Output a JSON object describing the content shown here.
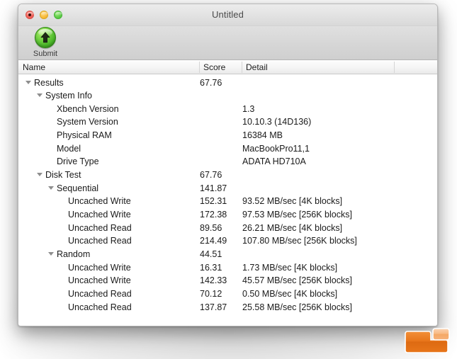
{
  "window": {
    "title": "Untitled",
    "traffic_lights": [
      {
        "name": "close",
        "color": "#f2655c"
      },
      {
        "name": "minimize",
        "color": "#f9bd3f"
      },
      {
        "name": "maximize",
        "color": "#62cf4a"
      }
    ]
  },
  "toolbar": {
    "submit_label": "Submit",
    "submit_icon": "green-up-arrow-icon"
  },
  "table": {
    "columns": [
      "Name",
      "Score",
      "Detail"
    ],
    "rows": [
      {
        "indent": 0,
        "expandable": true,
        "name": "Results",
        "score": "67.76",
        "detail": ""
      },
      {
        "indent": 1,
        "expandable": true,
        "name": "System Info",
        "score": "",
        "detail": ""
      },
      {
        "indent": 2,
        "expandable": false,
        "name": "Xbench Version",
        "score": "",
        "detail": "1.3"
      },
      {
        "indent": 2,
        "expandable": false,
        "name": "System Version",
        "score": "",
        "detail": "10.10.3 (14D136)"
      },
      {
        "indent": 2,
        "expandable": false,
        "name": "Physical RAM",
        "score": "",
        "detail": "16384 MB"
      },
      {
        "indent": 2,
        "expandable": false,
        "name": "Model",
        "score": "",
        "detail": "MacBookPro11,1"
      },
      {
        "indent": 2,
        "expandable": false,
        "name": "Drive Type",
        "score": "",
        "detail": "ADATA HD710A"
      },
      {
        "indent": 1,
        "expandable": true,
        "name": "Disk Test",
        "score": "67.76",
        "detail": ""
      },
      {
        "indent": 2,
        "expandable": true,
        "name": "Sequential",
        "score": "141.87",
        "detail": ""
      },
      {
        "indent": 3,
        "expandable": false,
        "name": "Uncached Write",
        "score": "152.31",
        "detail": "93.52 MB/sec [4K blocks]"
      },
      {
        "indent": 3,
        "expandable": false,
        "name": "Uncached Write",
        "score": "172.38",
        "detail": "97.53 MB/sec [256K blocks]"
      },
      {
        "indent": 3,
        "expandable": false,
        "name": "Uncached Read",
        "score": "89.56",
        "detail": "26.21 MB/sec [4K blocks]"
      },
      {
        "indent": 3,
        "expandable": false,
        "name": "Uncached Read",
        "score": "214.49",
        "detail": "107.80 MB/sec [256K blocks]"
      },
      {
        "indent": 2,
        "expandable": true,
        "name": "Random",
        "score": "44.51",
        "detail": ""
      },
      {
        "indent": 3,
        "expandable": false,
        "name": "Uncached Write",
        "score": "16.31",
        "detail": "1.73 MB/sec [4K blocks]"
      },
      {
        "indent": 3,
        "expandable": false,
        "name": "Uncached Write",
        "score": "142.33",
        "detail": "45.57 MB/sec [256K blocks]"
      },
      {
        "indent": 3,
        "expandable": false,
        "name": "Uncached Read",
        "score": "70.12",
        "detail": "0.50 MB/sec [4K blocks]"
      },
      {
        "indent": 3,
        "expandable": false,
        "name": "Uncached Read",
        "score": "137.87",
        "detail": "25.58 MB/sec [256K blocks]"
      }
    ]
  },
  "watermark": {
    "name": "orange-logo",
    "color_main": "#e8761a",
    "color_light": "#f7b27a"
  }
}
